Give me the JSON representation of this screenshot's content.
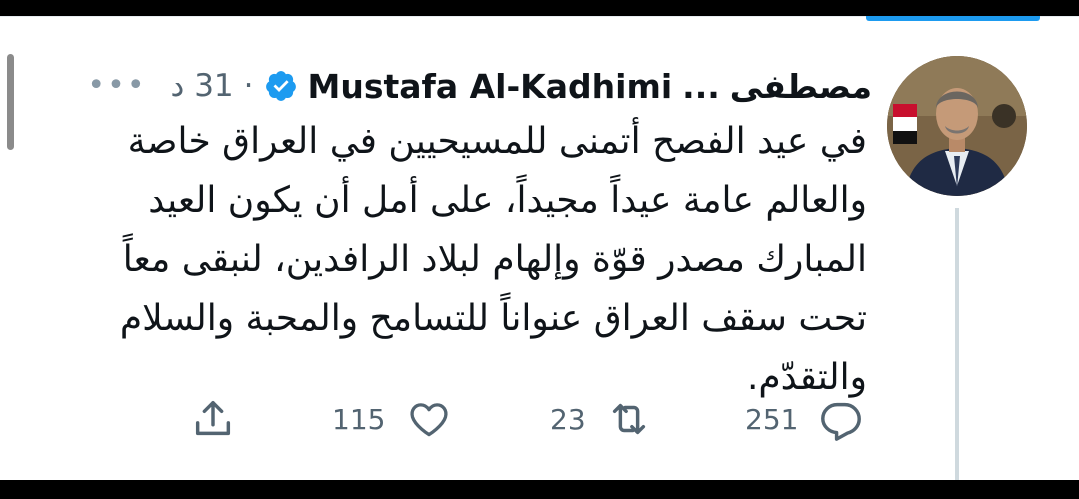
{
  "tweet": {
    "author_name_arabic": "مصطفى",
    "author_name_latin": "Mustafa Al-Kadhimi",
    "name_truncation": "...",
    "separator": "·",
    "time": "31 د",
    "more_icon": "more-dots-icon",
    "verified_icon": "verified-badge-icon",
    "text_lines": [
      "في عيد الفصح أتمنى للمسيحيين في العراق خاصة",
      "والعالم عامة عيداً مجيداً، على أمل أن يكون العيد",
      "المبارك مصدر قوّة وإلهام لبلاد الرافدين، لنبقى معاً",
      "تحت سقف العراق عنواناً للتسامح والمحبة والسلام",
      "والتقدّم."
    ],
    "actions": {
      "share_icon": "share-icon",
      "like_icon": "heart-icon",
      "like_count": "115",
      "retweet_icon": "retweet-icon",
      "retweet_count": "23",
      "reply_icon": "reply-icon",
      "reply_count": "251"
    }
  },
  "colors": {
    "accent": "#1d9bf0",
    "text": "#0f1419",
    "secondary": "#536471"
  }
}
